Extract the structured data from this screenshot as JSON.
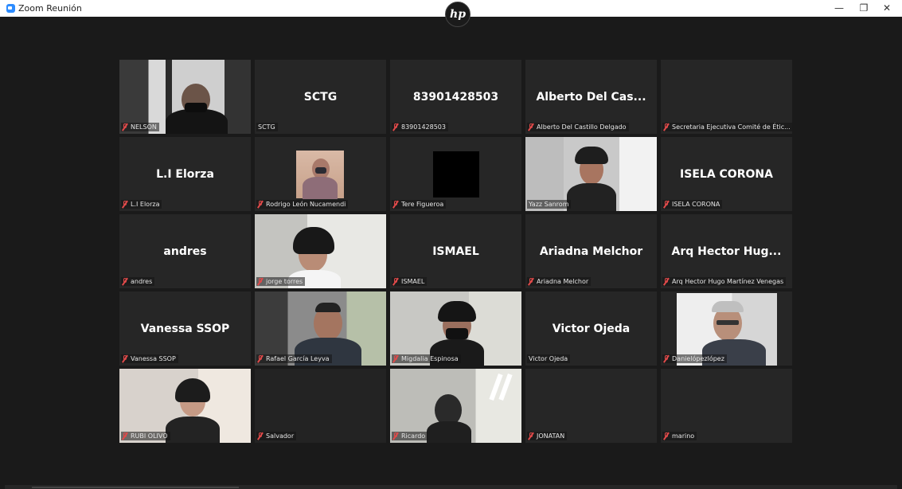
{
  "window": {
    "title": "Zoom Reunión",
    "minimize": "—",
    "maximize": "❐",
    "close": "✕"
  },
  "brand": {
    "logo_text": "hp"
  },
  "participants": [
    {
      "label": "NELSON",
      "display": "",
      "muted": true,
      "video": true
    },
    {
      "label": "SCTG",
      "display": "SCTG",
      "muted": false,
      "video": false
    },
    {
      "label": "83901428503",
      "display": "83901428503",
      "muted": true,
      "video": false
    },
    {
      "label": "Alberto Del Castillo Delgado",
      "display": "Alberto Del Cas...",
      "muted": true,
      "video": false
    },
    {
      "label": "Secretaria Ejecutiva Comité de Étic...",
      "display": "",
      "muted": true,
      "video": false
    },
    {
      "label": "L.I Elorza",
      "display": "L.I Elorza",
      "muted": true,
      "video": false
    },
    {
      "label": "Rodrigo León Nucamendi",
      "display": "",
      "muted": true,
      "video": true
    },
    {
      "label": "Tere Figueroa",
      "display": "",
      "muted": true,
      "video": true
    },
    {
      "label": "Yazz Sanrom",
      "display": "",
      "muted": false,
      "video": true,
      "speaking": true
    },
    {
      "label": "ISELA CORONA",
      "display": "ISELA CORONA",
      "muted": true,
      "video": false
    },
    {
      "label": "andres",
      "display": "andres",
      "muted": true,
      "video": false
    },
    {
      "label": "jorge torres",
      "display": "",
      "muted": true,
      "video": true
    },
    {
      "label": "ISMAEL",
      "display": "ISMAEL",
      "muted": true,
      "video": false
    },
    {
      "label": "Ariadna Melchor",
      "display": "Ariadna Melchor",
      "muted": true,
      "video": false
    },
    {
      "label": "Arq Hector Hugo Martínez Venegas",
      "display": "Arq Hector Hug...",
      "muted": true,
      "video": false
    },
    {
      "label": "Vanessa SSOP",
      "display": "Vanessa SSOP",
      "muted": true,
      "video": false
    },
    {
      "label": "Rafael García Leyva",
      "display": "",
      "muted": true,
      "video": true
    },
    {
      "label": "Migdalia Espinosa",
      "display": "",
      "muted": true,
      "video": true
    },
    {
      "label": "Victor Ojeda",
      "display": "Victor Ojeda",
      "muted": false,
      "video": false
    },
    {
      "label": "Danielópezlópez",
      "display": "",
      "muted": true,
      "video": true
    },
    {
      "label": "RUBI OLIVO",
      "display": "",
      "muted": true,
      "video": true
    },
    {
      "label": "Salvador",
      "display": "",
      "muted": true,
      "video": true
    },
    {
      "label": "Ricardo",
      "display": "",
      "muted": true,
      "video": true
    },
    {
      "label": "JONATAN",
      "display": "",
      "muted": true,
      "video": false
    },
    {
      "label": "marino",
      "display": "",
      "muted": true,
      "video": false
    }
  ]
}
